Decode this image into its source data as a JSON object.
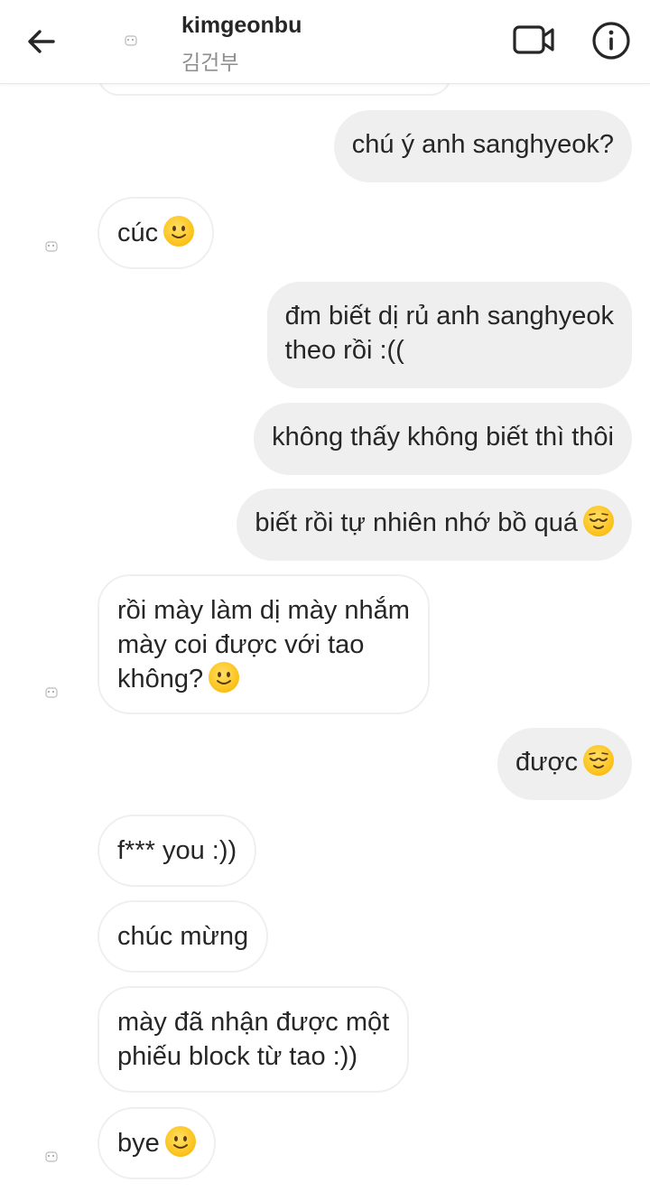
{
  "header": {
    "username": "kimgeonbu",
    "real_name": "김건부",
    "back_icon": "arrow-left-icon",
    "video_icon": "video-call-icon",
    "info_icon": "info-icon"
  },
  "messages": [
    {
      "sender": "me",
      "text": "chú ý anh sanghyeok?"
    },
    {
      "sender": "them",
      "text": "cúc",
      "emoji": "slightly-smiling-face"
    },
    {
      "sender": "me",
      "lines": [
        "đm biết dị rủ anh sanghyeok",
        "theo rồi :(("
      ]
    },
    {
      "sender": "me",
      "text": "không thấy không biết thì thôi"
    },
    {
      "sender": "me",
      "text": "biết rồi tự nhiên nhớ bồ quá",
      "emoji": "relieved-face"
    },
    {
      "sender": "them",
      "lines": [
        "rồi mày làm dị mày nhắm",
        "mày coi được với tao",
        "không?"
      ],
      "emoji": "slightly-smiling-face"
    },
    {
      "sender": "me",
      "text": "được",
      "emoji": "relieved-face"
    },
    {
      "sender": "them",
      "text": "f*** you :))"
    },
    {
      "sender": "them",
      "text": "chúc mừng"
    },
    {
      "sender": "them",
      "lines": [
        "mày đã nhận được một",
        "phiếu block từ tao :))"
      ]
    },
    {
      "sender": "them",
      "text": "bye",
      "emoji": "slightly-smiling-face"
    }
  ],
  "colors": {
    "sent_bubble": "#efefef",
    "received_bubble_border": "#efefef",
    "text": "#262626",
    "secondary_text": "#8e8e8e"
  }
}
